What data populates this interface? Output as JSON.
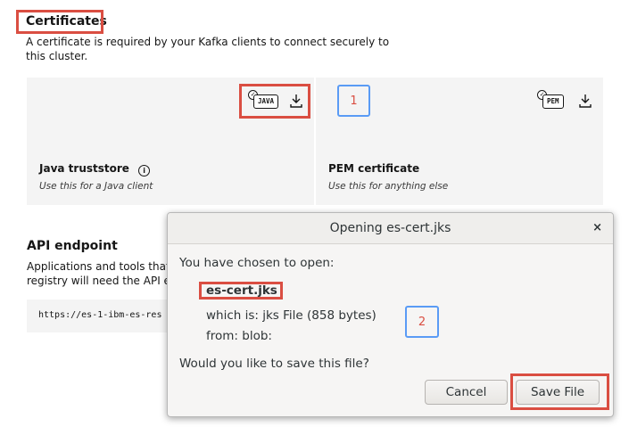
{
  "certificates": {
    "title": "Certificates",
    "description": "A certificate is required by your Kafka clients to connect securely to this cluster.",
    "java": {
      "badge": "JAVA",
      "title": "Java truststore",
      "info_icon": "info-icon",
      "subtitle": "Use this for a Java client"
    },
    "pem": {
      "badge": "PEM",
      "title": "PEM certificate",
      "subtitle": "Use this for anything else"
    },
    "download_icon": "download-icon",
    "annotation_1": "1"
  },
  "api": {
    "title": "API endpoint",
    "description_line1": "Applications and tools that u",
    "description_line2": "registry will need the API er",
    "url": "https://es-1-ibm-es-res"
  },
  "dialog": {
    "title": "Opening es-cert.jks",
    "close": "×",
    "chosen_label": "You have chosen to open:",
    "filename": "es-cert.jks",
    "which_is": "which is: jks File (858 bytes)",
    "from": "from: blob:",
    "question": "Would you like to save this file?",
    "cancel_label": "Cancel",
    "save_label": "Save File",
    "annotation_2": "2"
  },
  "colors": {
    "highlight_red": "#da4e42",
    "annotation_blue": "#5a9bf5",
    "tile_bg": "#f4f4f4"
  }
}
